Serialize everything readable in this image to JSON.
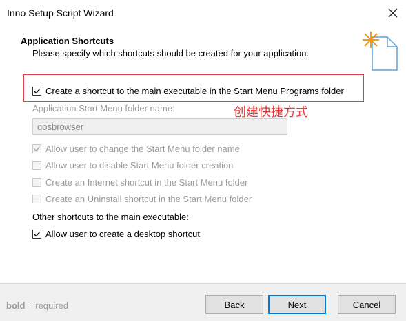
{
  "window": {
    "title": "Inno Setup Script Wizard"
  },
  "header": {
    "title": "Application Shortcuts",
    "subtitle": "Please specify which shortcuts should be created for your application."
  },
  "options": {
    "start_menu_shortcut": {
      "label": "Create a shortcut to the main executable in the Start Menu Programs folder",
      "checked": true,
      "enabled": true
    },
    "folder_name_label": "Application Start Menu folder name:",
    "folder_name_value": "qosbrowser",
    "allow_change_folder": {
      "label": "Allow user to change the Start Menu folder name",
      "checked": true,
      "enabled": false
    },
    "allow_disable_folder": {
      "label": "Allow user to disable Start Menu folder creation",
      "checked": false,
      "enabled": false
    },
    "internet_shortcut": {
      "label": "Create an Internet shortcut in the Start Menu folder",
      "checked": false,
      "enabled": false
    },
    "uninstall_shortcut": {
      "label": "Create an Uninstall shortcut in the Start Menu folder",
      "checked": false,
      "enabled": false
    }
  },
  "other": {
    "label": "Other shortcuts to the main executable:",
    "desktop_shortcut": {
      "label": "Allow user to create a desktop shortcut",
      "checked": true,
      "enabled": true
    }
  },
  "annotation": {
    "text": "创建快捷方式",
    "color": "#e23b3b"
  },
  "footer": {
    "required_bold": "bold",
    "required_rest": " = required",
    "back_label": "Back",
    "next_label": "Next",
    "cancel_label": "Cancel"
  },
  "colors": {
    "accent": "#0078d7",
    "annotation": "#e23b3b"
  }
}
